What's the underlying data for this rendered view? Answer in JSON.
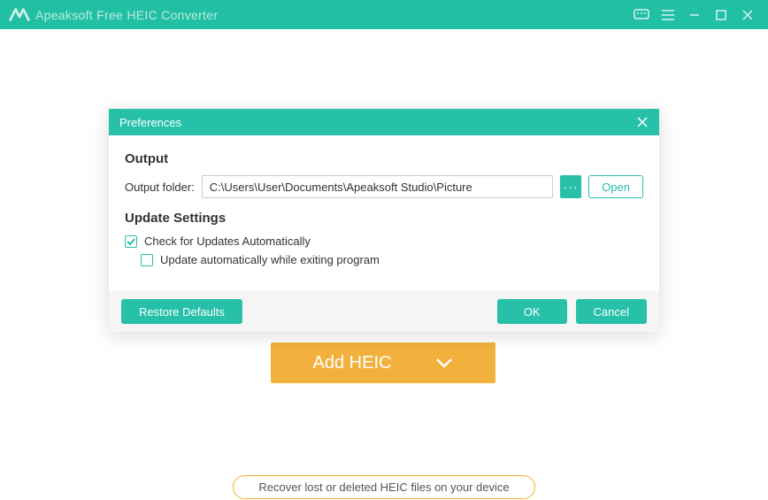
{
  "titlebar": {
    "app_title": "Apeaksoft Free HEIC Converter"
  },
  "main": {
    "add_button_label": "Add HEIC",
    "recover_link_label": "Recover lost or deleted HEIC files on your device"
  },
  "dialog": {
    "title": "Preferences",
    "output": {
      "section_title": "Output",
      "folder_label": "Output folder:",
      "folder_value": "C:\\Users\\User\\Documents\\Apeaksoft Studio\\Picture",
      "browse_glyph": "···",
      "open_label": "Open"
    },
    "updates": {
      "section_title": "Update Settings",
      "check_auto_label": "Check for Updates Automatically",
      "check_auto_checked": true,
      "exit_update_label": "Update automatically while exiting program",
      "exit_update_checked": false
    },
    "footer": {
      "restore_label": "Restore Defaults",
      "ok_label": "OK",
      "cancel_label": "Cancel"
    }
  },
  "icons": {
    "feedback": "feedback-icon",
    "menu": "menu-icon",
    "minimize": "minimize-icon",
    "maximize": "maximize-icon",
    "close": "close-icon"
  },
  "colors": {
    "accent": "#27c0a9",
    "accent2": "#f1b13c"
  }
}
